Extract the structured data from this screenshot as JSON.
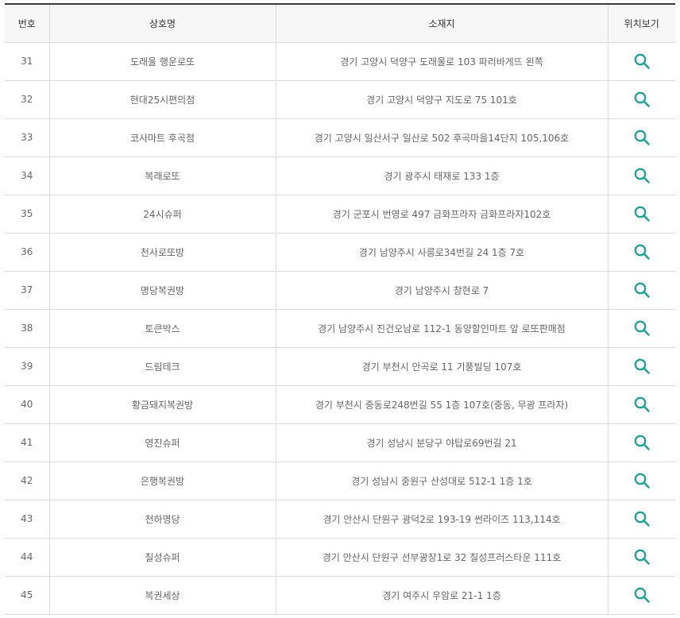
{
  "accent_color": "#1aa39a",
  "table": {
    "headers": {
      "no": "번호",
      "name": "상호명",
      "address": "소재지",
      "location": "위치보기"
    },
    "rows": [
      {
        "no": "31",
        "name": "도래울 행운로또",
        "address": "경기 고양시 덕양구 도래울로 103 파리바게뜨 왼쪽",
        "icon": "search-icon"
      },
      {
        "no": "32",
        "name": "현대25시편의점",
        "address": "경기 고양시 덕양구 지도로 75 101호",
        "icon": "search-icon"
      },
      {
        "no": "33",
        "name": "코사마트 후곡점",
        "address": "경기 고양시 일산서구 일산로 502 후곡마을14단지 105,106호",
        "icon": "search-icon"
      },
      {
        "no": "34",
        "name": "복래로또",
        "address": "경기 광주시 태재로 133 1층",
        "icon": "search-icon"
      },
      {
        "no": "35",
        "name": "24시슈퍼",
        "address": "경기 군포시 번영로 497 금화프라자 금화프라자102호",
        "icon": "search-icon"
      },
      {
        "no": "36",
        "name": "천사로또방",
        "address": "경기 남양주시 사릉로34번길 24 1층 7호",
        "icon": "search-icon"
      },
      {
        "no": "37",
        "name": "명당복권방",
        "address": "경기 남양주시 창현로 7",
        "icon": "search-icon"
      },
      {
        "no": "38",
        "name": "토큰박스",
        "address": "경기 남양주시 진건오남로 112-1 동양할인마트 앞 로또판매점",
        "icon": "search-icon"
      },
      {
        "no": "39",
        "name": "드림테크",
        "address": "경기 부천시 안곡로 11 기풍빌딩 107호",
        "icon": "search-icon"
      },
      {
        "no": "40",
        "name": "황금돼지복권방",
        "address": "경기 부천시 중동로248번길 55 1층 107호(중동, 무광 프라자)",
        "icon": "search-icon"
      },
      {
        "no": "41",
        "name": "영진슈퍼",
        "address": "경기 성남시 분당구 야탑로69번길 21",
        "icon": "search-icon"
      },
      {
        "no": "42",
        "name": "은행복권방",
        "address": "경기 성남시 중원구 산성대로 512-1 1층 1호",
        "icon": "search-icon"
      },
      {
        "no": "43",
        "name": "천하명당",
        "address": "경기 안산시 단원구 광덕2로 193-19 썬라이즈 113,114호",
        "icon": "search-icon"
      },
      {
        "no": "44",
        "name": "칠성슈퍼",
        "address": "경기 안산시 단원구 선부광장1로 32 칠성프러스타운 111호",
        "icon": "search-icon"
      },
      {
        "no": "45",
        "name": "복권세상",
        "address": "경기 여주시 우암로 21-1 1층",
        "icon": "search-icon"
      }
    ]
  }
}
